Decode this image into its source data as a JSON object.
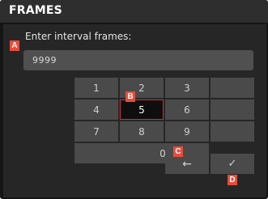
{
  "header": {
    "title": "FRAMES"
  },
  "prompt": "Enter interval frames:",
  "value_field": {
    "value": "9999"
  },
  "keypad": {
    "rows": [
      [
        {
          "label": "1"
        },
        {
          "label": "2"
        },
        {
          "label": "3"
        },
        {
          "label": ""
        }
      ],
      [
        {
          "label": "4"
        },
        {
          "label": "5",
          "selected": true
        },
        {
          "label": "6"
        },
        {
          "label": ""
        }
      ],
      [
        {
          "label": "7"
        },
        {
          "label": "8"
        },
        {
          "label": "9"
        },
        {
          "label": ""
        }
      ],
      [
        {
          "label": "0"
        },
        {
          "label": "←",
          "icon": "backspace-icon"
        },
        {
          "label": "✓",
          "icon": "confirm-check-icon"
        }
      ]
    ]
  },
  "callouts": {
    "a": "A",
    "b": "B",
    "c": "C",
    "d": "D"
  },
  "colors": {
    "callout": "#e74c3c",
    "selected_border": "#c8323c",
    "background": "#151515",
    "key": "#4a4a4a"
  }
}
